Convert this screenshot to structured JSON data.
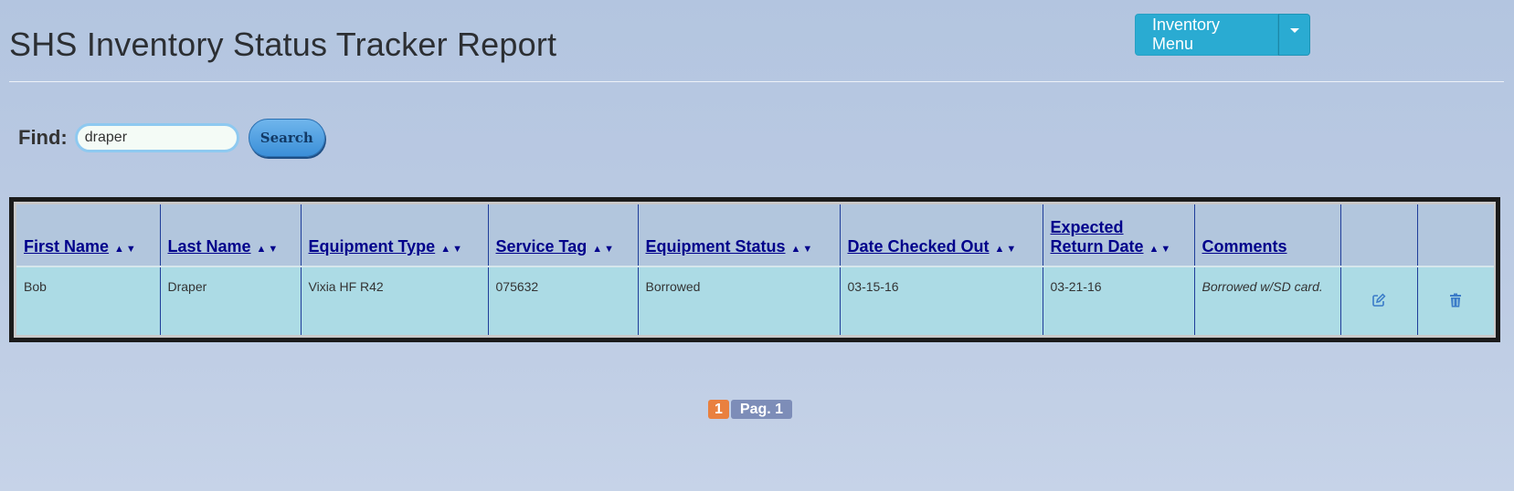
{
  "header": {
    "title": "SHS Inventory Status Tracker Report",
    "menu_label": "Inventory Menu"
  },
  "search": {
    "label": "Find:",
    "value": "draper",
    "button_label": "Search"
  },
  "table": {
    "columns": [
      {
        "label": "First Name",
        "sortable": true
      },
      {
        "label": "Last Name",
        "sortable": true
      },
      {
        "label": "Equipment Type",
        "sortable": true
      },
      {
        "label": "Service Tag",
        "sortable": true
      },
      {
        "label": "Equipment Status",
        "sortable": true
      },
      {
        "label": "Date Checked Out",
        "sortable": true
      },
      {
        "label_line1": "Expected",
        "label_line2": "Return Date",
        "sortable": true
      },
      {
        "label": "Comments",
        "sortable": false
      }
    ],
    "sort_arrows": "▲▼",
    "rows": [
      {
        "first_name": "Bob",
        "last_name": "Draper",
        "equipment_type": "Vixia HF R42",
        "service_tag": "075632",
        "equipment_status": "Borrowed",
        "date_checked_out": "03-15-16",
        "expected_return_date": "03-21-16",
        "comments": "Borrowed w/SD card."
      }
    ],
    "row_icons": [
      "edit-icon",
      "trash-icon"
    ]
  },
  "pagination": {
    "current_page": "1",
    "label": "Pag. 1"
  },
  "colors": {
    "accent_button": "#2aabd2",
    "header_bg": "#b2c6dd",
    "row_bg": "#acdbe5",
    "link": "#00008b",
    "pager_current": "#e9803f"
  }
}
